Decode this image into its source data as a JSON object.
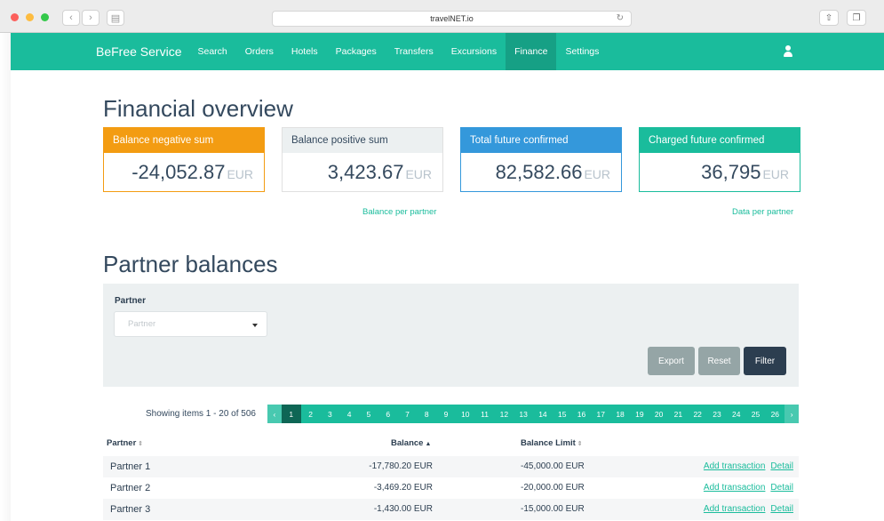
{
  "browser": {
    "url": "travelNET.io"
  },
  "nav": {
    "brand": "BeFree Service",
    "items": [
      {
        "label": "Search"
      },
      {
        "label": "Orders"
      },
      {
        "label": "Hotels"
      },
      {
        "label": "Packages"
      },
      {
        "label": "Transfers"
      },
      {
        "label": "Excursions"
      },
      {
        "label": "Finance",
        "active": true
      },
      {
        "label": "Settings"
      }
    ],
    "user_icon": "user-icon"
  },
  "overview": {
    "title": "Financial overview",
    "cards": [
      {
        "label": "Balance negative sum",
        "value": "-24,052.87",
        "unit": "EUR"
      },
      {
        "label": "Balance positive sum",
        "value": "3,423.67",
        "unit": "EUR"
      },
      {
        "label": "Total future confirmed",
        "value": "82,582.66",
        "unit": "EUR"
      },
      {
        "label": "Charged future confirmed",
        "value": "36,795",
        "unit": "EUR"
      }
    ],
    "links": {
      "balance_per_partner": "Balance per partner",
      "data_per_partner": "Data per partner"
    },
    "colors": {
      "orange": "#f39c12",
      "blue": "#3498db",
      "teal": "#1abc9c"
    }
  },
  "balances": {
    "title": "Partner balances",
    "filter": {
      "label": "Partner",
      "placeholder": "Partner",
      "export": "Export",
      "reset": "Reset",
      "filter": "Filter"
    },
    "showing": "Showing items 1 - 20 of 506",
    "pages": [
      "1",
      "2",
      "3",
      "4",
      "5",
      "6",
      "7",
      "8",
      "9",
      "10",
      "11",
      "12",
      "13",
      "14",
      "15",
      "16",
      "17",
      "18",
      "19",
      "20",
      "21",
      "22",
      "23",
      "24",
      "25",
      "26"
    ],
    "current_page": "1",
    "columns": {
      "partner": "Partner",
      "balance": "Balance",
      "limit": "Balance Limit"
    },
    "rows": [
      {
        "partner": "Partner 1",
        "balance": "-17,780.20 EUR",
        "limit": "-45,000.00 EUR",
        "add": "Add transaction",
        "detail": "Detail"
      },
      {
        "partner": "Partner 2",
        "balance": "-3,469.20 EUR",
        "limit": "-20,000.00 EUR",
        "add": "Add transaction",
        "detail": "Detail"
      },
      {
        "partner": "Partner 3",
        "balance": "-1,430.00 EUR",
        "limit": "-15,000.00 EUR",
        "add": "Add transaction",
        "detail": "Detail"
      }
    ]
  }
}
